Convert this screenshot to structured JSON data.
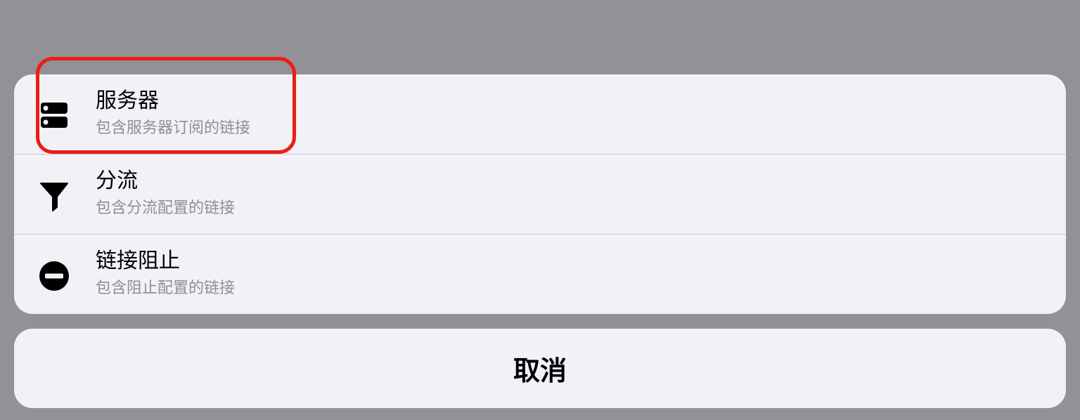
{
  "action_sheet": {
    "options": [
      {
        "title": "服务器",
        "subtitle": "包含服务器订阅的链接",
        "icon": "server-icon"
      },
      {
        "title": "分流",
        "subtitle": "包含分流配置的链接",
        "icon": "filter-icon"
      },
      {
        "title": "链接阻止",
        "subtitle": "包含阻止配置的链接",
        "icon": "block-icon"
      }
    ]
  },
  "cancel_label": "取消",
  "highlight": {
    "target": "服务器",
    "color": "#ee1c16"
  },
  "colors": {
    "overlay": "#929196",
    "sheet": "#f2f1f7",
    "subtitle": "#8e8e93",
    "divider": "#c8c7cc"
  }
}
